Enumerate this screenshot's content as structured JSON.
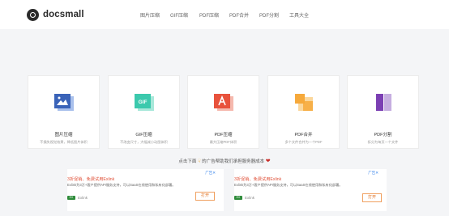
{
  "header": {
    "logo_text": "docsmall",
    "nav": [
      "图片压缩",
      "GIF压缩",
      "PDF压缩",
      "PDF合并",
      "PDF分割",
      "工具大全"
    ]
  },
  "tools": [
    {
      "title": "图片压缩",
      "desc": "不損失视觉效果，降低图片体积",
      "icon": "image-icon",
      "color": "#3a63b8"
    },
    {
      "title": "GIF压缩",
      "desc": "不改变尺寸，大幅减小动图体积",
      "icon": "gif-icon",
      "color": "#3cc9ad"
    },
    {
      "title": "PDF压缩",
      "desc": "最大压缩PDF体积",
      "icon": "pdf-icon",
      "color": "#e8523c"
    },
    {
      "title": "PDF合并",
      "desc": "多个文件合并为一个PDF",
      "icon": "merge-icon",
      "color": "#f6a93b"
    },
    {
      "title": "PDF分割",
      "desc": "拆分为每页一个文件",
      "icon": "split-icon",
      "color": "#7b3fb3"
    }
  ],
  "notice": {
    "prefix": "点击下面",
    "text": "的广告帮助我们承担服务器成本"
  },
  "ads": [
    {
      "flag": "广告✕",
      "headline": "3折促销、免费试用Exlink",
      "sub": "Exlink为3万+客户提供API服务支持，可以SaaS在线使用和私有化部署。",
      "brand": "Exlink",
      "button": "打开"
    },
    {
      "flag": "广告✕",
      "headline": "3折促销、免费试用Exlink",
      "sub": "Exlink为3万+客户提供API服务支持，可以SaaS在线使用和私有化部署。",
      "brand": "Exlink",
      "button": "打开"
    }
  ]
}
